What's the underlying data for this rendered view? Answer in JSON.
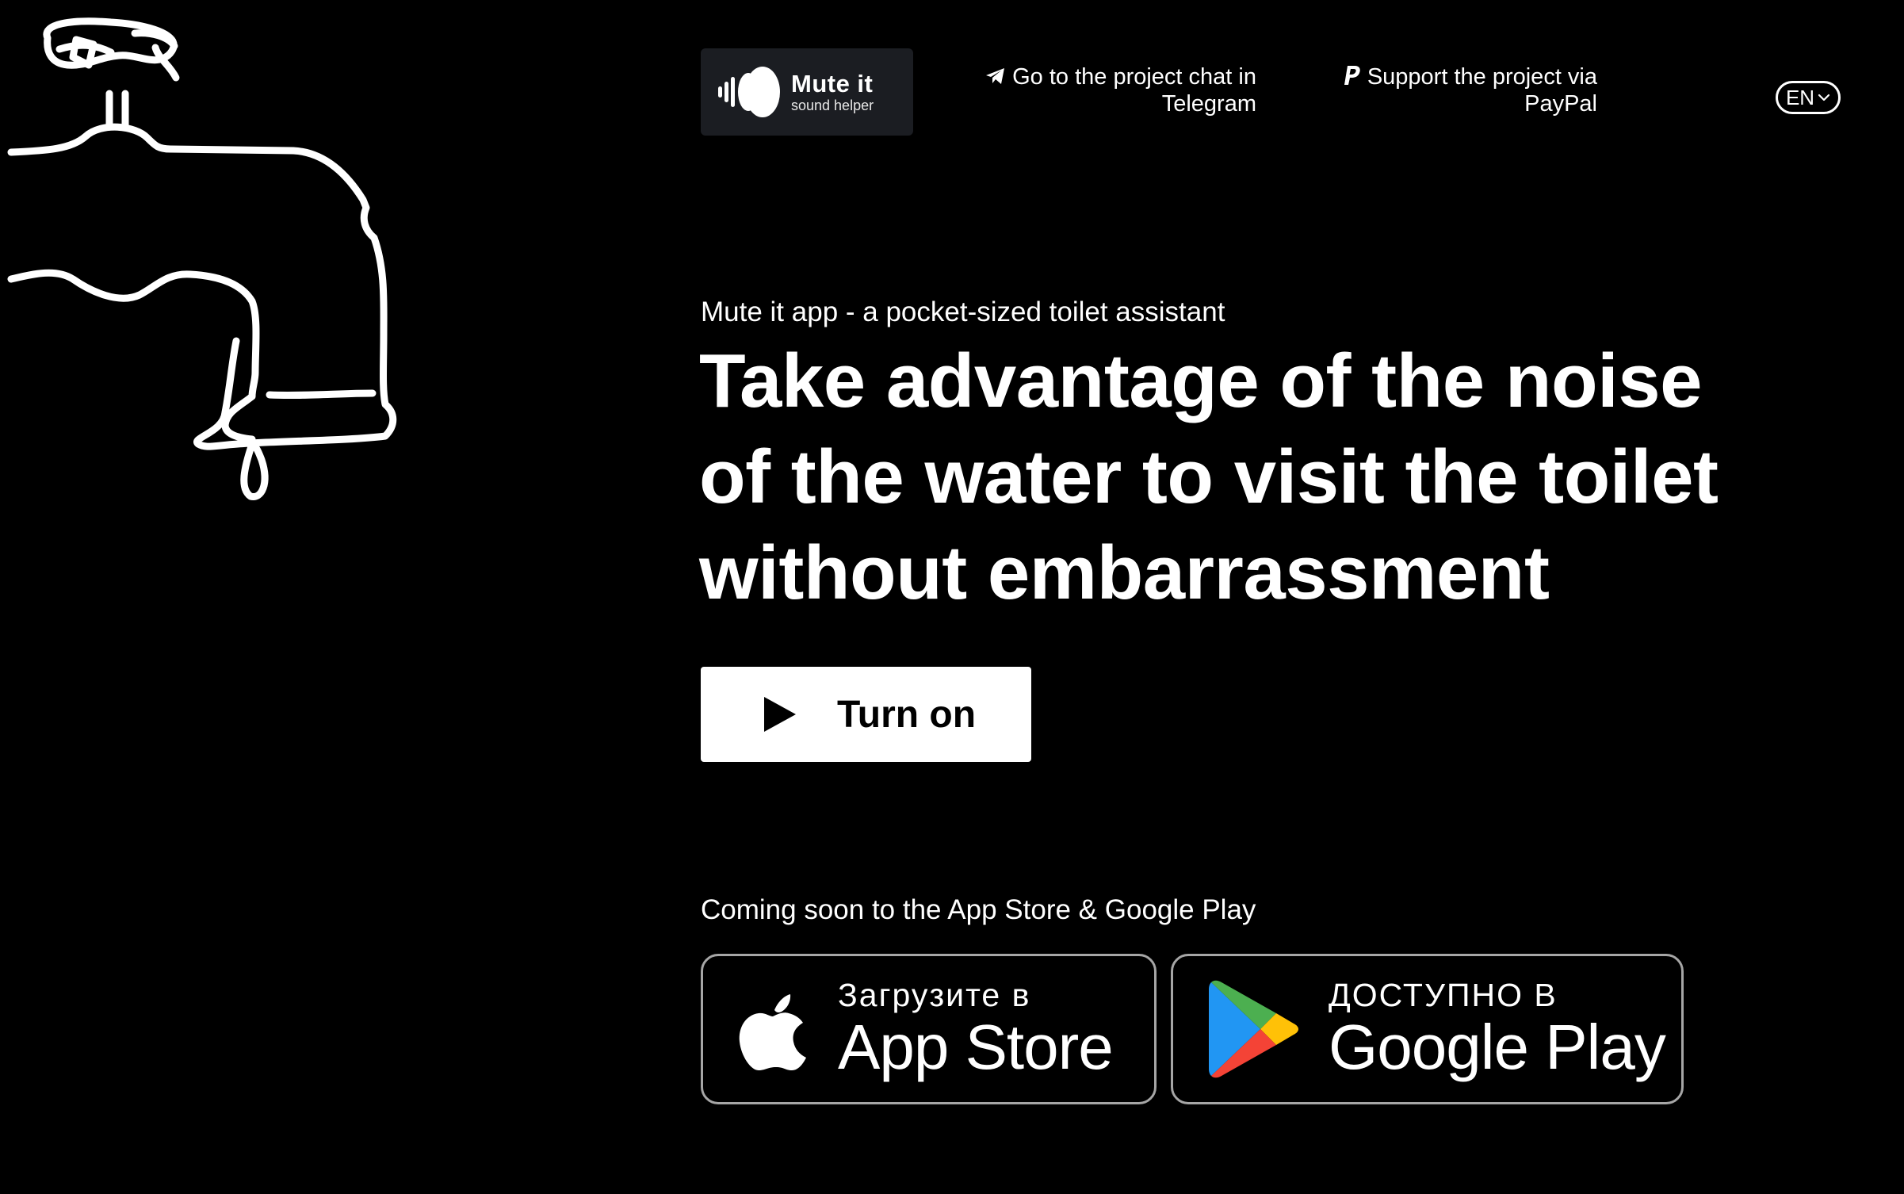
{
  "logo": {
    "name": "Mute it",
    "tagline": "sound helper"
  },
  "nav": {
    "telegram_label": "Go to the project chat in Telegram",
    "paypal_label": "Support the project via PayPal",
    "language": "EN"
  },
  "hero": {
    "eyebrow": "Mute it app - a pocket-sized toilet assistant",
    "headline": "Take advantage of the noise of the water to visit the toilet without embarrassment",
    "button_label": "Turn on"
  },
  "stores": {
    "coming_soon": "Coming soon to the App Store & Google Play",
    "apple": {
      "small": "Загрузите в",
      "big": "App Store"
    },
    "google": {
      "small": "ДОСТУПНО В",
      "big": "Google Play"
    }
  },
  "colors": {
    "background": "#000000",
    "foreground": "#ffffff",
    "logo_bg": "#1b1d22",
    "badge_border": "#a6a6a6"
  },
  "icons": [
    "faucet-illustration",
    "logo-mark-icon",
    "telegram-icon",
    "paypal-icon",
    "chevron-down-icon",
    "play-icon",
    "apple-icon",
    "google-play-icon"
  ]
}
